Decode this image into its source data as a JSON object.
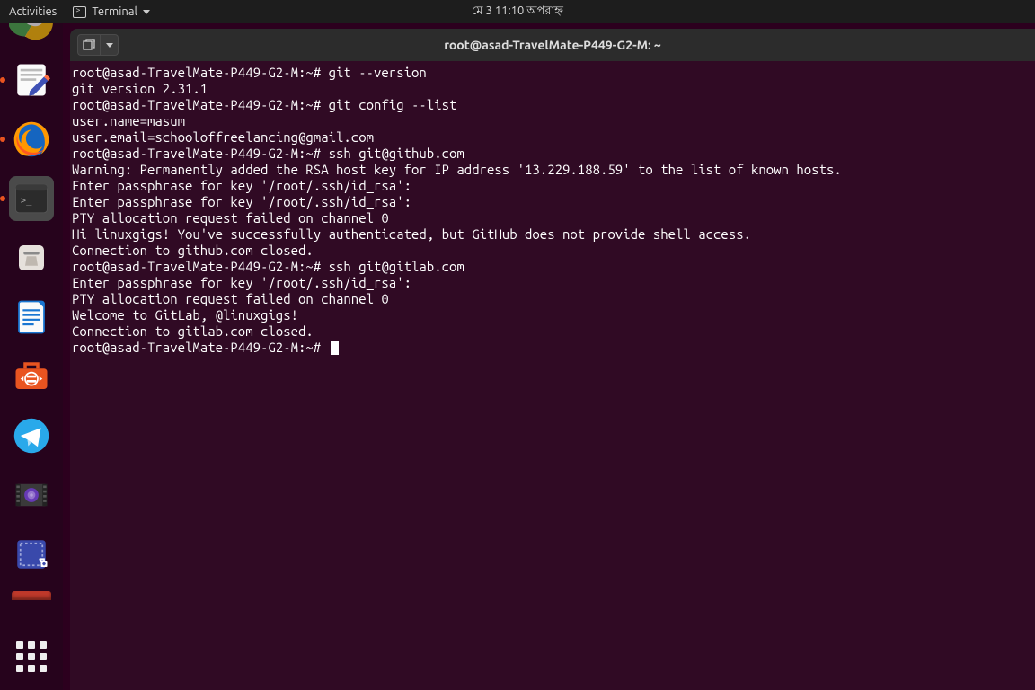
{
  "panel": {
    "activities": "Activities",
    "app_label": "Terminal",
    "clock": "মে 3  11:10 অপরাহ্ন"
  },
  "window": {
    "title": "root@asad-TravelMate-P449-G2-M: ~"
  },
  "dock": {
    "items": [
      {
        "name": "chrome"
      },
      {
        "name": "text-editor"
      },
      {
        "name": "firefox"
      },
      {
        "name": "terminal"
      },
      {
        "name": "files"
      },
      {
        "name": "libreoffice-writer"
      },
      {
        "name": "software-center"
      },
      {
        "name": "telegram"
      },
      {
        "name": "video"
      },
      {
        "name": "screenshot"
      }
    ]
  },
  "terminal": {
    "lines": [
      {
        "prompt": "root@asad-TravelMate-P449-G2-M:~#",
        "cmd": " git --version"
      },
      {
        "out": "git version 2.31.1"
      },
      {
        "prompt": "root@asad-TravelMate-P449-G2-M:~#",
        "cmd": " git config --list"
      },
      {
        "out": "user.name=masum"
      },
      {
        "out": "user.email=schooloffreelancing@gmail.com"
      },
      {
        "prompt": "root@asad-TravelMate-P449-G2-M:~#",
        "cmd": " ssh git@github.com"
      },
      {
        "out": "Warning: Permanently added the RSA host key for IP address '13.229.188.59' to the list of known hosts."
      },
      {
        "out": "Enter passphrase for key '/root/.ssh/id_rsa':"
      },
      {
        "out": "Enter passphrase for key '/root/.ssh/id_rsa':"
      },
      {
        "out": "PTY allocation request failed on channel 0"
      },
      {
        "out": "Hi linuxgigs! You've successfully authenticated, but GitHub does not provide shell access."
      },
      {
        "out": "Connection to github.com closed."
      },
      {
        "prompt": "root@asad-TravelMate-P449-G2-M:~#",
        "cmd": " ssh git@gitlab.com"
      },
      {
        "out": "Enter passphrase for key '/root/.ssh/id_rsa':"
      },
      {
        "out": "PTY allocation request failed on channel 0"
      },
      {
        "out": "Welcome to GitLab, @linuxgigs!"
      },
      {
        "out": "Connection to gitlab.com closed."
      },
      {
        "prompt": "root@asad-TravelMate-P449-G2-M:~#",
        "cmd": " ",
        "cursor": true
      }
    ]
  }
}
